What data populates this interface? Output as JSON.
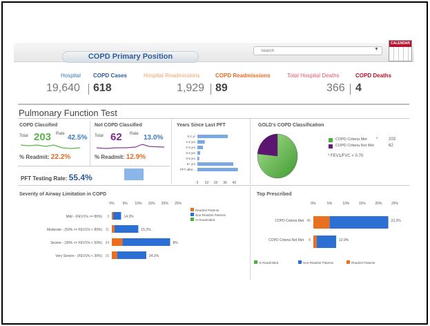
{
  "header": {
    "title": "COPD Primary Position",
    "search_placeholder": "Search",
    "calendar_label": "CALENDAR"
  },
  "kpis": [
    {
      "label": "Hospital",
      "value": "19,640",
      "color": "#3b7bbf"
    },
    {
      "label": "COPD Cases",
      "value": "618",
      "color": "#2c5b9b"
    },
    {
      "label": "Hospital Readmissions",
      "value": "1,929",
      "color": "#f3a36b"
    },
    {
      "label": "COPD Readmissions",
      "value": "89",
      "color": "#e86a1e"
    },
    {
      "label": "Total Hospital Deaths",
      "value": "366",
      "color": "#e05a6b"
    },
    {
      "label": "COPD Deaths",
      "value": "4",
      "color": "#b8122e"
    }
  ],
  "pft": {
    "section_title": "Pulmonary Function Test",
    "classified": {
      "title": "COPD Classified",
      "total_label": "Total",
      "total": "203",
      "rate_label": "Rate",
      "rate": "42.5%",
      "readmit_label": "% Readmit:",
      "readmit": "22.2%"
    },
    "not_classified": {
      "title": "Not COPD Classified",
      "total_label": "Total",
      "total": "62",
      "rate_label": "Rate",
      "rate": "13.0%",
      "readmit_label": "% Readmit:",
      "readmit": "12.9%"
    },
    "testing_rate_label": "PFT Testing Rate:",
    "testing_rate": "55.4%",
    "testing_rate_fraction": 0.554
  },
  "years_chart": {
    "title": "Years Since Last PFT",
    "categories": [
      "0-1 yr",
      "1-2 yrs",
      "2-3 yrs",
      "3-4 yrs",
      "4-5 yrs",
      "5+ yrs",
      "PFT after..."
    ],
    "values": [
      33,
      8,
      6,
      3,
      2,
      39,
      44
    ],
    "ticks": [
      "0",
      "10",
      "20",
      "30",
      "40"
    ],
    "xlim": [
      0,
      45
    ],
    "color": "#7aa8e3"
  },
  "gold": {
    "title": "GOLD's COPD Classification",
    "legend": [
      {
        "label": "COPD Criteria Met",
        "marker": "*",
        "value": "203",
        "color": "#4caf3e"
      },
      {
        "label": "COPD Criteria Not Met",
        "marker": "",
        "value": "62",
        "color": "#6a1a82"
      }
    ],
    "footnote": "* FEV1/FVC < 0.70"
  },
  "severity": {
    "title": "Severity of Airway Limitation in COPD",
    "ticks": [
      "0%",
      "5%",
      "10%",
      "15%",
      "20%",
      "25%"
    ],
    "rows": [
      {
        "label": "Mild - (FEV1% >= 80%)",
        "n": "3",
        "readmit": 0.5,
        "nonreadmit": 3,
        "pct": "14.3%"
      },
      {
        "label": "Moderate - (50% <= FEV1% < 80%)",
        "n": "11",
        "readmit": 1,
        "nonreadmit": 9,
        "pct": "15.2%"
      },
      {
        "label": "Severe - (30% <= FEV1% < 50%)",
        "n": "24",
        "readmit": 4,
        "nonreadmit": 18,
        "pct": "8%"
      },
      {
        "label": "Very Severe - (FEV1% < 30%)",
        "n": "15",
        "readmit": 2,
        "nonreadmit": 11,
        "pct": "24.2%"
      }
    ],
    "legend": [
      "Readmit Patients",
      "Non-Readmit Patients",
      "% Readmitted"
    ]
  },
  "top_prescribed": {
    "title": "Top Prescribed",
    "ticks": [
      "0%",
      "5%",
      "10%",
      "15%",
      "20%",
      "25%"
    ],
    "rows": [
      {
        "label": "COPD Criteria Met",
        "n": "45",
        "readmit": 5,
        "nonreadmit": 18,
        "pct": "22.2%"
      },
      {
        "label": "COPD Criteria Not Met",
        "n": "8",
        "readmit": 1,
        "nonreadmit": 6,
        "pct": "12.9%"
      }
    ],
    "legend": [
      "% Readmitted",
      "Non-Readmit Patients",
      "Readmit Patients"
    ]
  },
  "colors": {
    "blue": "#2a6fd1",
    "orange": "#e8701e",
    "green": "#4caf3e",
    "purple": "#7b2a8a"
  }
}
